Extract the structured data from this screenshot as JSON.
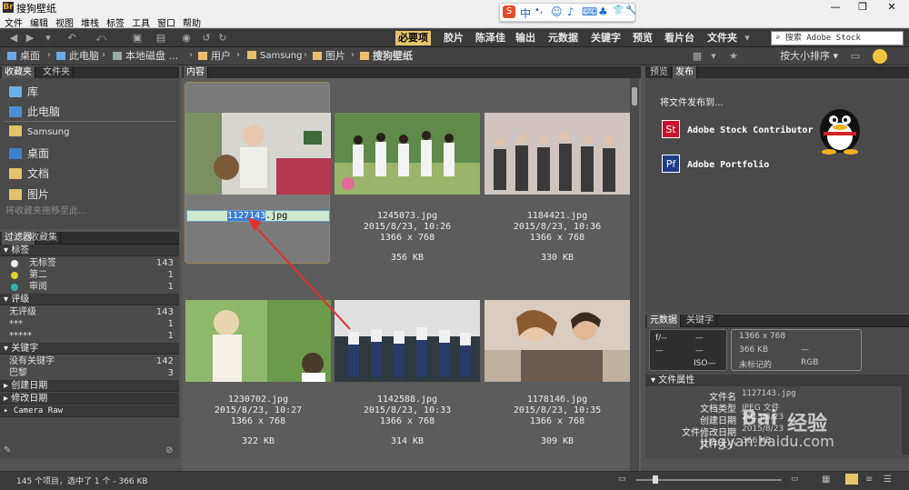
{
  "app": {
    "title": "搜狗壁纸"
  },
  "window_controls": {
    "minimize": "—",
    "maximize": "❐",
    "close": "✕"
  },
  "menu": [
    "文件",
    "编辑",
    "视图",
    "堆栈",
    "标签",
    "工具",
    "窗口",
    "帮助"
  ],
  "ime": {
    "logo": "S",
    "lang": "中",
    "punct": "•,",
    "icons": [
      "☺",
      "♪",
      "⌨",
      "♣",
      "👕",
      "🔧"
    ]
  },
  "toolbar": {
    "workspaces": [
      "必要项",
      "胶片",
      "陈泽佳",
      "输出",
      "元数据",
      "关键字",
      "预览",
      "看片台",
      "文件夹"
    ],
    "active_workspace": "必要项",
    "search_placeholder": "搜索 Adobe Stock",
    "search_icon": "search-icon"
  },
  "path": [
    "桌面",
    "此电脑",
    "本地磁盘 ...",
    "用户",
    "Samsung",
    "图片",
    "搜狗壁纸"
  ],
  "sort": {
    "label": "按大小排序"
  },
  "left_panel": {
    "tabs": [
      "收藏夹",
      "文件夹"
    ],
    "items": [
      "库",
      "此电脑",
      "Samsung",
      "桌面",
      "文档",
      "图片"
    ],
    "drop_hint": "将收藏夹拖移至此..."
  },
  "filter_panel": {
    "tabs": [
      "过滤器",
      "收藏集"
    ],
    "sections": [
      {
        "title": "标签",
        "rows": [
          {
            "label": "无标签",
            "count": "143"
          },
          {
            "label": "第二",
            "count": "1"
          },
          {
            "label": "审阅",
            "count": "1"
          }
        ]
      },
      {
        "title": "评级",
        "rows": [
          {
            "label": "无评级",
            "count": "143"
          },
          {
            "label": "***",
            "count": "1"
          },
          {
            "label": "*****",
            "count": "1"
          }
        ]
      },
      {
        "title": "关键字",
        "rows": [
          {
            "label": "没有关键字",
            "count": "142"
          },
          {
            "label": "巴黎",
            "count": "3"
          }
        ]
      },
      {
        "title": "创建日期",
        "rows": []
      },
      {
        "title": "修改日期",
        "rows": []
      },
      {
        "title": "Camera Raw",
        "rows": []
      }
    ]
  },
  "content": {
    "tab": "内容",
    "items": [
      {
        "name_sel": "1127143",
        "name_ext": ".jpg",
        "date": "",
        "dims": "",
        "size": ""
      },
      {
        "name": "1245073.jpg",
        "date": "2015/8/23, 10:26",
        "dims": "1366 x 768",
        "size": "356 KB"
      },
      {
        "name": "1184421.jpg",
        "date": "2015/8/23, 10:36",
        "dims": "1366 x 768",
        "size": "330 KB"
      },
      {
        "name": "1230702.jpg",
        "date": "2015/8/23, 10:27",
        "dims": "1366 x 768",
        "size": "322 KB"
      },
      {
        "name": "1142588.jpg",
        "date": "2015/8/23, 10:33",
        "dims": "1366 x 768",
        "size": "314 KB"
      },
      {
        "name": "1178146.jpg",
        "date": "2015/8/23, 10:35",
        "dims": "1366 x 768",
        "size": "309 KB"
      }
    ]
  },
  "right_panel": {
    "tabs": [
      "预览",
      "发布"
    ],
    "publish_title": "将文件发布到...",
    "targets": [
      {
        "icon": "St",
        "label": "Adobe Stock Contributor",
        "color": "#c8102e"
      },
      {
        "icon": "Pf",
        "label": "Adobe Portfolio",
        "color": "#1f3b8c"
      }
    ]
  },
  "metadata_panel": {
    "tabs": [
      "元数据",
      "关键字"
    ],
    "camera": {
      "fstop": "f/--",
      "dash1": "—",
      "dash2": "—",
      "dash3": "—",
      "iso": "ISO—"
    },
    "file_info": {
      "dims": "1366 x 768",
      "size": "366 KB",
      "dash": "—",
      "unmarked": "未标记的",
      "mode": "RGB"
    },
    "section": "文件属性",
    "props": [
      {
        "k": "文件名",
        "v": "1127143.jpg"
      },
      {
        "k": "文档类型",
        "v": "JPEG 文件"
      },
      {
        "k": "创建日期",
        "v": "2015/8/23"
      },
      {
        "k": "文件修改日期",
        "v": "2015/8/23"
      },
      {
        "k": "文件大小",
        "v": "366 KB"
      }
    ]
  },
  "status": {
    "text": "145 个项目，选中了 1 个 - 366 KB"
  },
  "watermark": {
    "brand": "Bai",
    "brand2": "经验",
    "url": "jingyan.baidu.com"
  },
  "colors": {
    "accent": "#e8c56d",
    "selection": "#3b7ed6"
  }
}
